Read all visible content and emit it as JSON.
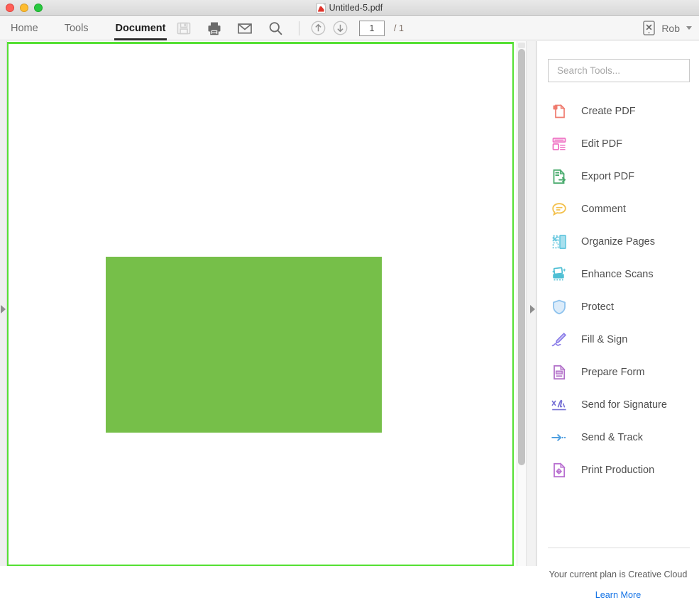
{
  "window": {
    "title": "Untitled-5.pdf",
    "file_icon": "pdf-file-icon",
    "controls": [
      "close",
      "minimize",
      "maximize"
    ]
  },
  "toolbar": {
    "tabs": [
      {
        "label": "Home",
        "active": false
      },
      {
        "label": "Tools",
        "active": false
      },
      {
        "label": "Document",
        "active": true
      }
    ],
    "icons": [
      {
        "name": "save-icon",
        "disabled": true
      },
      {
        "name": "print-icon",
        "disabled": false
      },
      {
        "name": "email-icon",
        "disabled": false
      },
      {
        "name": "search-icon",
        "disabled": false
      }
    ],
    "page_up_icon": "arrow-up-circle-icon",
    "page_down_icon": "arrow-down-circle-icon",
    "page_number": "1",
    "page_total": "/ 1",
    "mobile_icon": "mobile-device-x-icon",
    "account_name": "Rob",
    "account_caret": "chevron-down-icon"
  },
  "document": {
    "page_border_color": "#55e033",
    "shape_color": "#76bf49",
    "shape_name": "green-rectangle"
  },
  "tools_panel": {
    "search_placeholder": "Search Tools...",
    "search_value": "",
    "items": [
      {
        "label": "Create PDF",
        "icon": "create-pdf-icon",
        "color": "#ef7b6e"
      },
      {
        "label": "Edit PDF",
        "icon": "edit-pdf-icon",
        "color": "#ef72c4"
      },
      {
        "label": "Export PDF",
        "icon": "export-pdf-icon",
        "color": "#4aab6e"
      },
      {
        "label": "Comment",
        "icon": "comment-icon",
        "color": "#f3c04b"
      },
      {
        "label": "Organize Pages",
        "icon": "organize-pages-icon",
        "color": "#63c6de"
      },
      {
        "label": "Enhance Scans",
        "icon": "enhance-scans-icon",
        "color": "#4fbfd4"
      },
      {
        "label": "Protect",
        "icon": "protect-shield-icon",
        "color": "#8fc3ee"
      },
      {
        "label": "Fill & Sign",
        "icon": "fill-and-sign-icon",
        "color": "#8b7ee8"
      },
      {
        "label": "Prepare Form",
        "icon": "prepare-form-icon",
        "color": "#b271c9"
      },
      {
        "label": "Send for Signature",
        "icon": "send-for-signature-icon",
        "color": "#7a74d6"
      },
      {
        "label": "Send & Track",
        "icon": "send-and-track-icon",
        "color": "#4f9fe0"
      },
      {
        "label": "Print Production",
        "icon": "print-production-icon",
        "color": "#b86fd0"
      }
    ],
    "plan_text": "Your current plan is Creative Cloud",
    "learn_more_label": "Learn More"
  }
}
